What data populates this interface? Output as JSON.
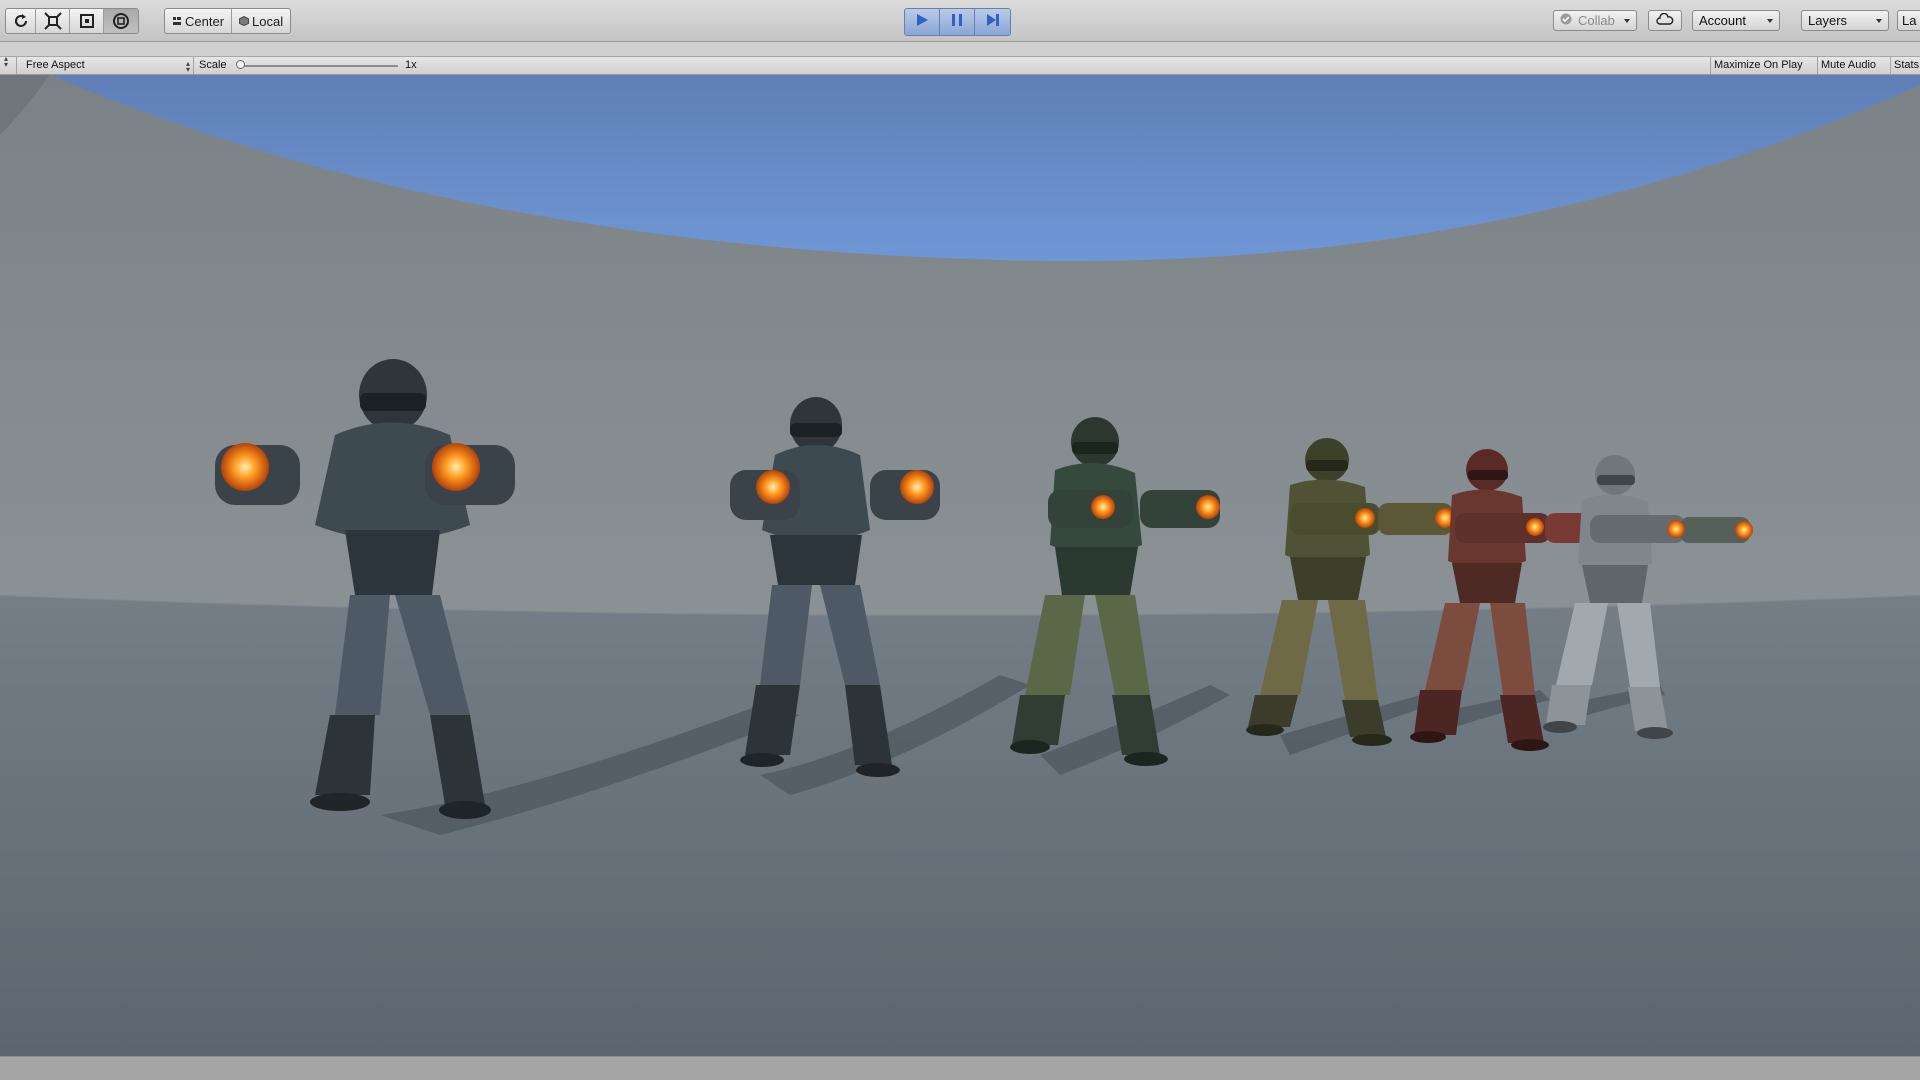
{
  "toolbar": {
    "transform_tools": [
      {
        "icon": "rotate-icon",
        "name": "rotate-tool"
      },
      {
        "icon": "scale-icon",
        "name": "scale-tool"
      },
      {
        "icon": "rect-tool-icon",
        "name": "rect-tool"
      },
      {
        "icon": "transform-tool-icon",
        "name": "transform-tool"
      }
    ],
    "pivot_center_label": "Center",
    "pivot_local_label": "Local",
    "collab_label": "Collab",
    "account_label": "Account",
    "layers_label": "Layers",
    "layout_label": "La"
  },
  "playback": {
    "play_icon": "play-icon",
    "pause_icon": "pause-icon",
    "step_icon": "step-icon",
    "playing": true,
    "accent_color": "#3d6fc4"
  },
  "game_view": {
    "aspect_label": "Free Aspect",
    "scale_label": "Scale",
    "scale_value": "1x",
    "scale_level": 0.0,
    "maximize_label": "Maximize On Play",
    "mute_label": "Mute Audio",
    "stats_label": "Stats"
  },
  "scene": {
    "sky_color": "#6b8fc9",
    "floor_color": "#6a747d",
    "characters": [
      {
        "name": "soldier-blue-camo-1",
        "suit": "#3e4a52",
        "camo": "#4d5a66",
        "weapon": "gauntlets"
      },
      {
        "name": "soldier-blue-camo-2",
        "suit": "#3e4a52",
        "camo": "#4d5a66",
        "weapon": "gauntlets"
      },
      {
        "name": "soldier-green-camo",
        "suit": "#35493d",
        "camo": "#5b6848",
        "weapon": "cannon"
      },
      {
        "name": "soldier-olive-camo",
        "suit": "#4f5234",
        "camo": "#6e6a45",
        "weapon": "cannon"
      },
      {
        "name": "soldier-red-camo",
        "suit": "#6a3630",
        "camo": "#7c4d3f",
        "weapon": "cannon"
      },
      {
        "name": "soldier-white-camo",
        "suit": "#7f878c",
        "camo": "#a2a9ae",
        "weapon": "cannon"
      }
    ]
  }
}
